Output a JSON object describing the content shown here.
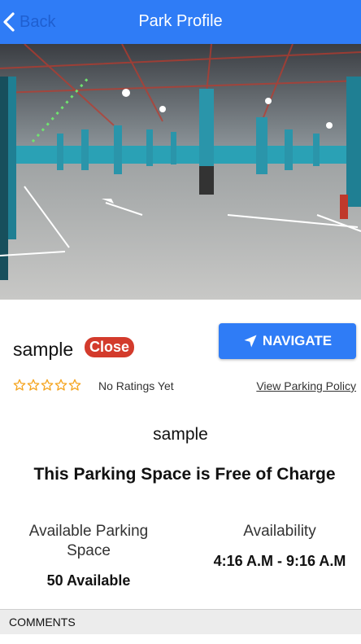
{
  "header": {
    "back_label": "Back",
    "title": "Park Profile"
  },
  "park": {
    "name": "sample",
    "status_badge": "Close",
    "navigate_label": "NAVIGATE",
    "rating": 0,
    "ratings_text": "No Ratings Yet",
    "policy_link": "View Parking Policy",
    "subtitle": "sample",
    "price_text": "This Parking Space is Free of Charge"
  },
  "availability": {
    "space_label": "Available Parking Space",
    "space_value": "50 Available",
    "hours_label": "Availability",
    "hours_value": "4:16 A.M - 9:16 A.M"
  },
  "comments": {
    "header": "COMMENTS"
  },
  "colors": {
    "primary": "#2f7cf6",
    "badge": "#d33b2c",
    "star": "#f5a623"
  }
}
